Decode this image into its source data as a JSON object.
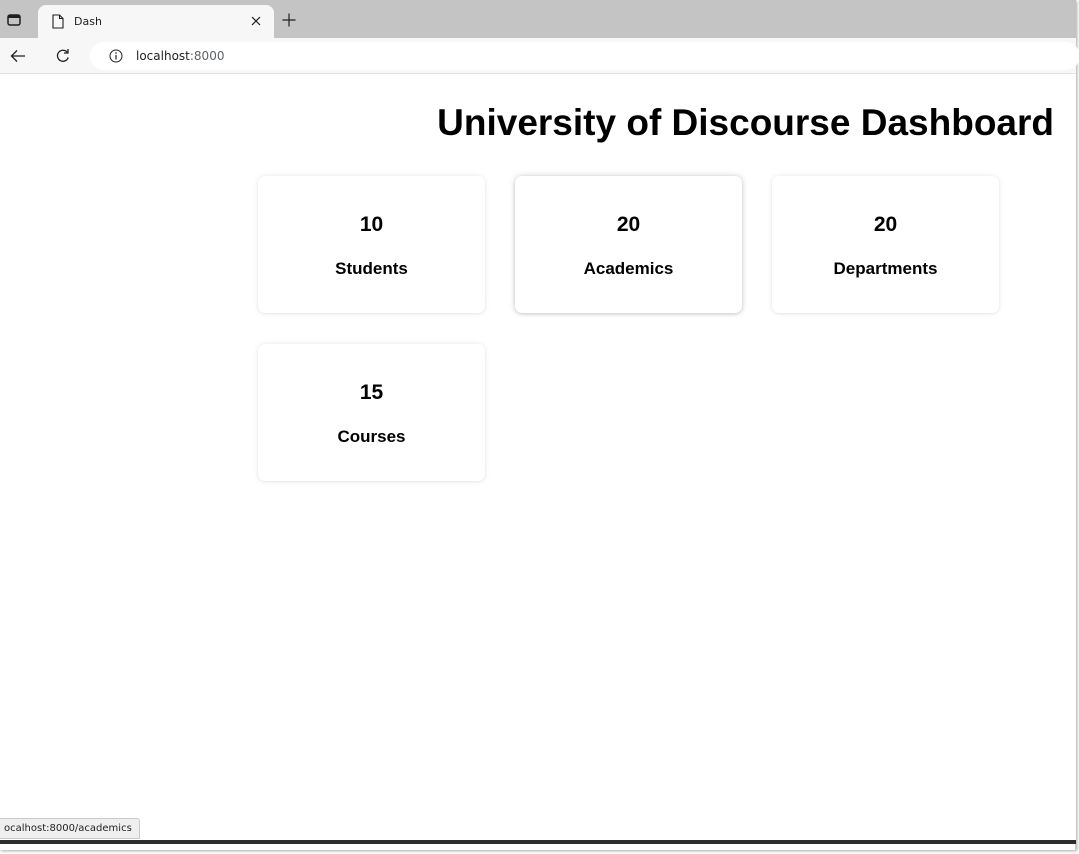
{
  "browser": {
    "tab": {
      "title": "Dash",
      "icon": "page-icon",
      "close_icon": "close-icon"
    },
    "new_tab_icon": "plus-icon",
    "tab_actions_icon": "tab-actions-icon",
    "back_icon": "arrow-left-icon",
    "reload_icon": "reload-icon",
    "address": {
      "info_icon": "info-icon",
      "host": "localhost",
      "port": ":8000"
    },
    "status_url": "ocalhost:8000/academics"
  },
  "page": {
    "title": "University of Discourse Dashboard",
    "cards": [
      {
        "count": "10",
        "label": "Students"
      },
      {
        "count": "20",
        "label": "Academics"
      },
      {
        "count": "20",
        "label": "Departments"
      },
      {
        "count": "15",
        "label": "Courses"
      }
    ]
  },
  "colors": {
    "tabstrip": "#c4c4c4",
    "toolbar": "#f7f7f7",
    "text": "#000000"
  }
}
